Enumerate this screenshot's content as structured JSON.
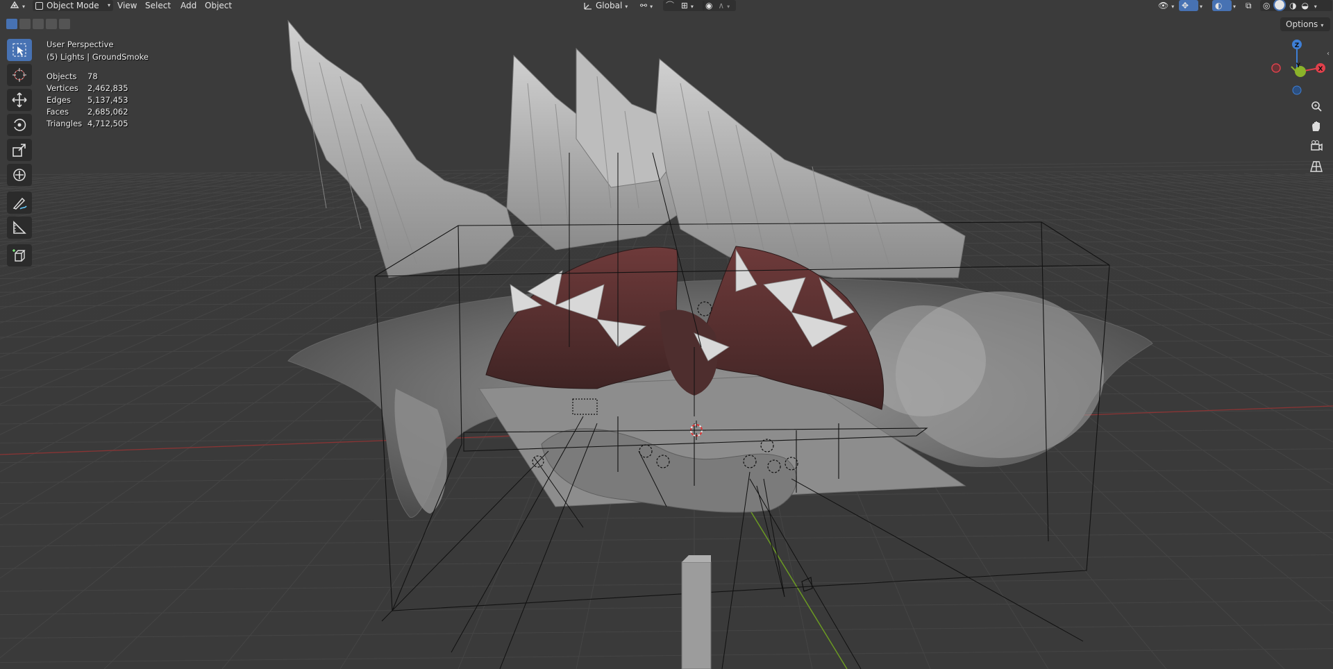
{
  "header": {
    "editor_type_icon": "editor-type-icon",
    "mode_label": "Object Mode",
    "menu": [
      "View",
      "Select",
      "Add",
      "Object"
    ],
    "transform_orientation": "Global",
    "options_label": "Options"
  },
  "overlay": {
    "view_name": "User Perspective",
    "collection_info": "(5) Lights | GroundSmoke",
    "stats": [
      {
        "label": "Objects",
        "value": "78"
      },
      {
        "label": "Vertices",
        "value": "2,462,835"
      },
      {
        "label": "Edges",
        "value": "5,137,453"
      },
      {
        "label": "Faces",
        "value": "2,685,062"
      },
      {
        "label": "Triangles",
        "value": "4,712,505"
      }
    ]
  },
  "gizmo": {
    "z_label": "Z",
    "y_label": "Y",
    "x_label": "X"
  },
  "tools": [
    "select-box-tool",
    "cursor-tool",
    "move-tool",
    "rotate-tool",
    "scale-tool",
    "transform-tool",
    "annotate-tool",
    "measure-tool",
    "add-cube-tool"
  ],
  "colors": {
    "accent": "#4772b3",
    "grid": "#454545",
    "x_axis": "#9b3a3a",
    "y_axis": "#6e9a25",
    "gizmo_x": "#e1404b",
    "gizmo_y": "#8bb32a",
    "gizmo_z": "#3e7fd6"
  }
}
